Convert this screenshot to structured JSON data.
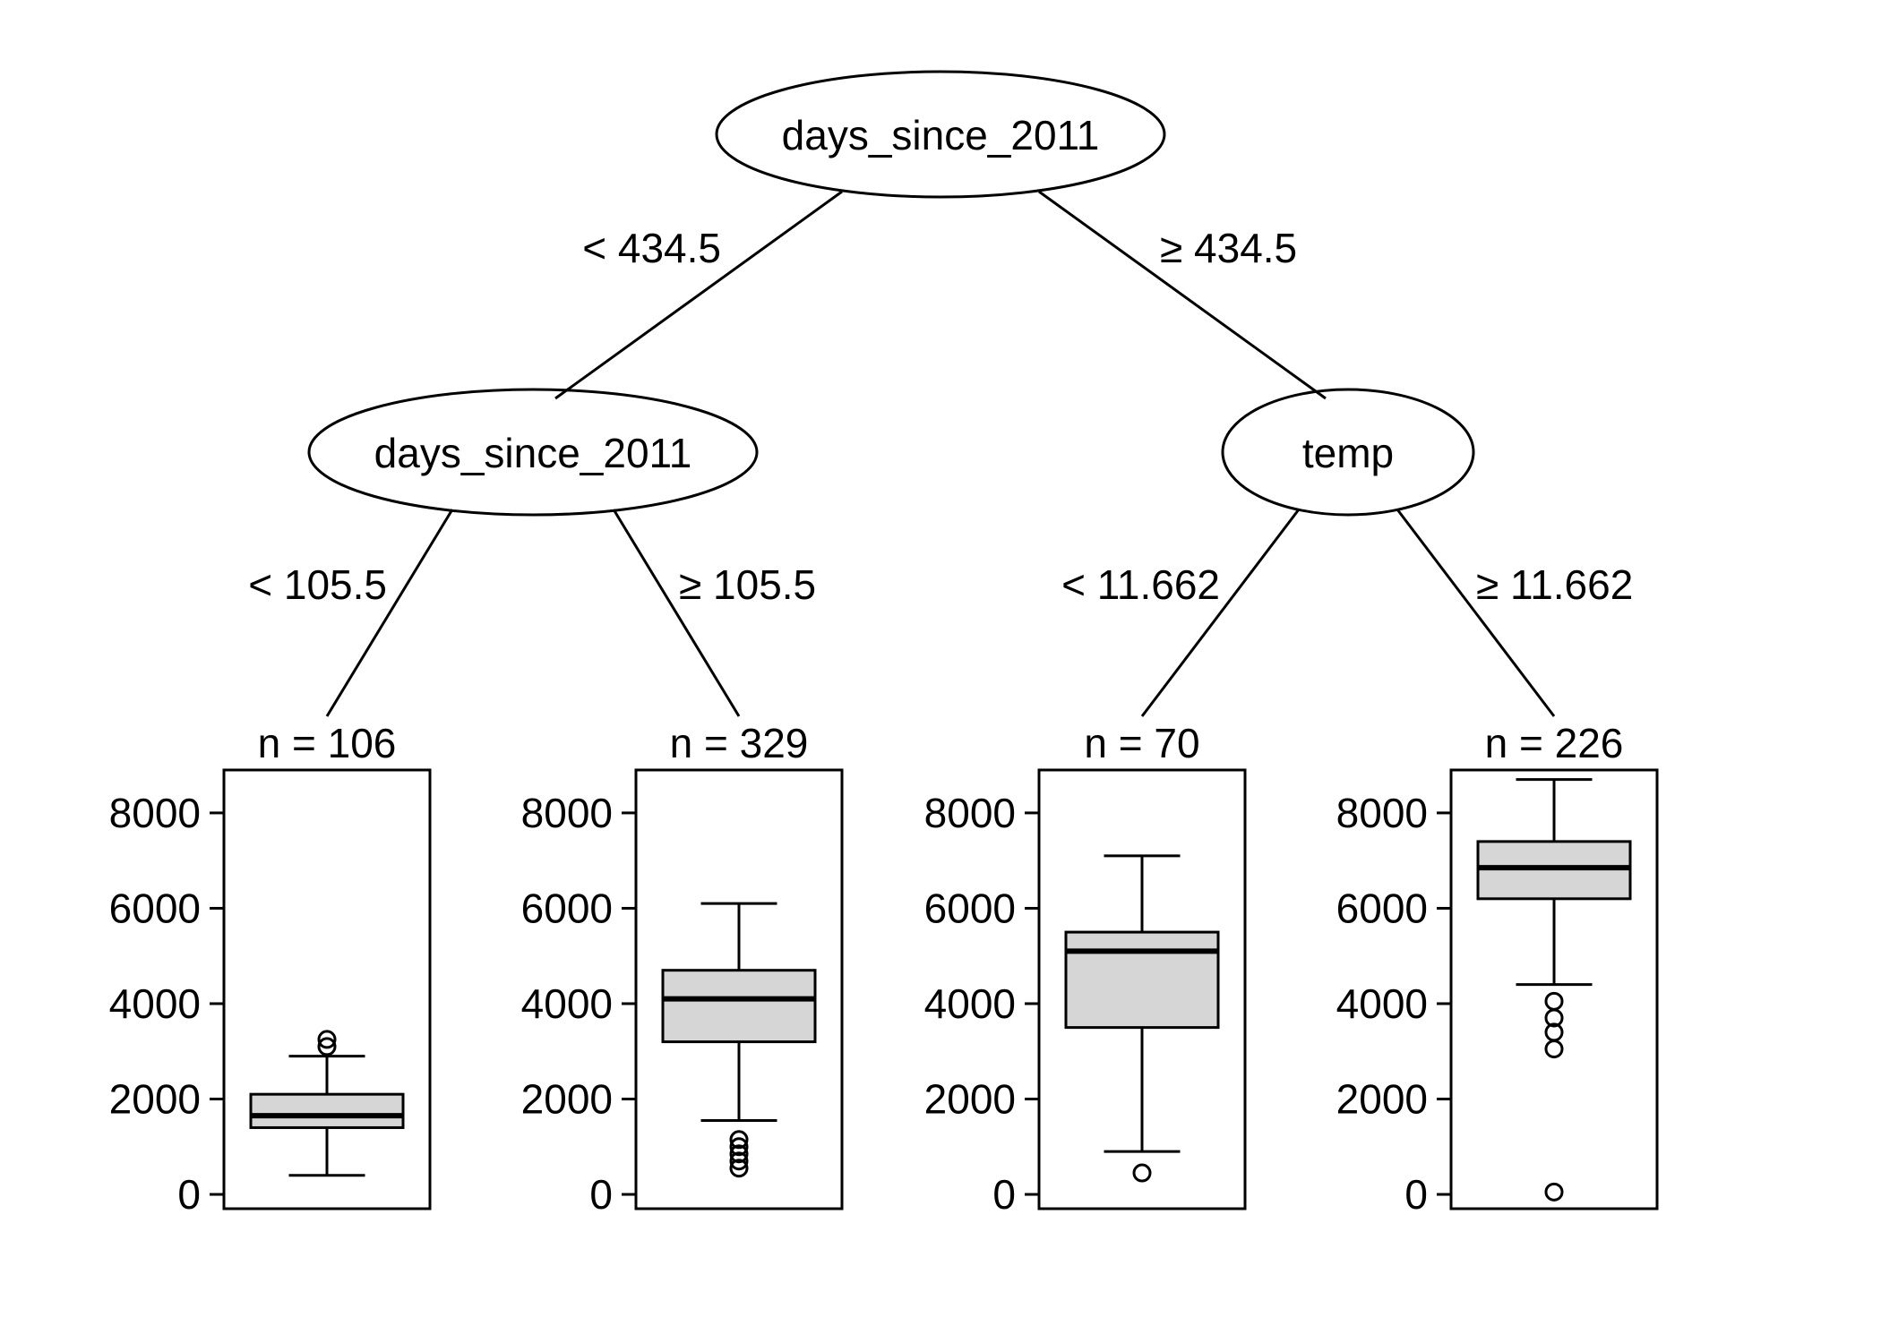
{
  "chart_data": {
    "type": "tree-boxplot",
    "title": "",
    "ylim": [
      0,
      8000
    ],
    "yticks": [
      0,
      2000,
      4000,
      6000,
      8000
    ],
    "root": {
      "label": "days_since_2011",
      "left_cond": "< 434.5",
      "right_cond": "≥ 434.5"
    },
    "left": {
      "label": "days_since_2011",
      "left_cond": "< 105.5",
      "right_cond": "≥ 105.5"
    },
    "right": {
      "label": "temp",
      "left_cond": "< 11.662",
      "right_cond": "≥ 11.662"
    },
    "leaves": [
      {
        "n_label": "n = 106",
        "n": 106,
        "box": {
          "min": 400,
          "q1": 1400,
          "median": 1650,
          "q3": 2100,
          "max": 2900
        },
        "outliers": [
          3100,
          3250
        ]
      },
      {
        "n_label": "n = 329",
        "n": 329,
        "box": {
          "min": 1550,
          "q1": 3200,
          "median": 4100,
          "q3": 4700,
          "max": 6100
        },
        "outliers": [
          550,
          700,
          850,
          1000,
          1150
        ]
      },
      {
        "n_label": "n = 70",
        "n": 70,
        "box": {
          "min": 900,
          "q1": 3500,
          "median": 5100,
          "q3": 5500,
          "max": 7100
        },
        "outliers": [
          450
        ]
      },
      {
        "n_label": "n = 226",
        "n": 226,
        "box": {
          "min": 4400,
          "q1": 6200,
          "median": 6850,
          "q3": 7400,
          "max": 8700
        },
        "outliers": [
          50,
          3050,
          3400,
          3700,
          4050
        ]
      }
    ]
  }
}
